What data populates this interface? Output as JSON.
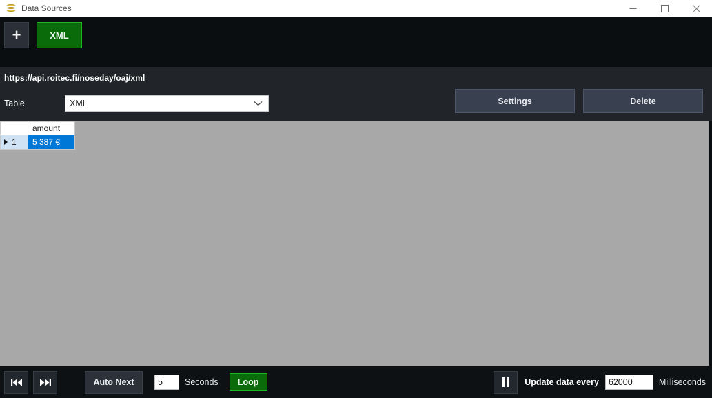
{
  "window": {
    "title": "Data Sources",
    "icon": "database-stack-icon",
    "minimize_label": "Minimize",
    "maximize_label": "Maximize",
    "close_label": "Close"
  },
  "toolbar": {
    "add_label": "+",
    "sources": [
      {
        "label": "XML",
        "active": true
      }
    ]
  },
  "source_panel": {
    "url": "https://api.roitec.fi/noseday/oaj/xml",
    "table_label": "Table",
    "table_value": "XML",
    "table_options": [
      "XML"
    ],
    "settings_label": "Settings",
    "delete_label": "Delete"
  },
  "grid": {
    "row_header_title": "",
    "columns": [
      "amount"
    ],
    "rows": [
      {
        "index": "1",
        "selected": true,
        "cells": [
          "5 387 €"
        ]
      }
    ]
  },
  "bottom_bar": {
    "first_label": "Skip to first",
    "next_label": "Skip to next",
    "auto_next_label": "Auto Next",
    "seconds_value": "5",
    "seconds_label": "Seconds",
    "loop_label": "Loop",
    "pause_label": "Pause",
    "update_label": "Update data every",
    "update_value": "62000",
    "update_unit": "Milliseconds"
  },
  "colors": {
    "toolbar_bg": "#0a0e11",
    "panel_bg": "#212529",
    "content_bg": "#a8a8a8",
    "accent_green": "#0a6b0a",
    "accent_green_border": "#1db81d",
    "selection_blue": "#0078d7",
    "row_header_blue": "#cfe3f5",
    "button_slate": "#394150"
  }
}
